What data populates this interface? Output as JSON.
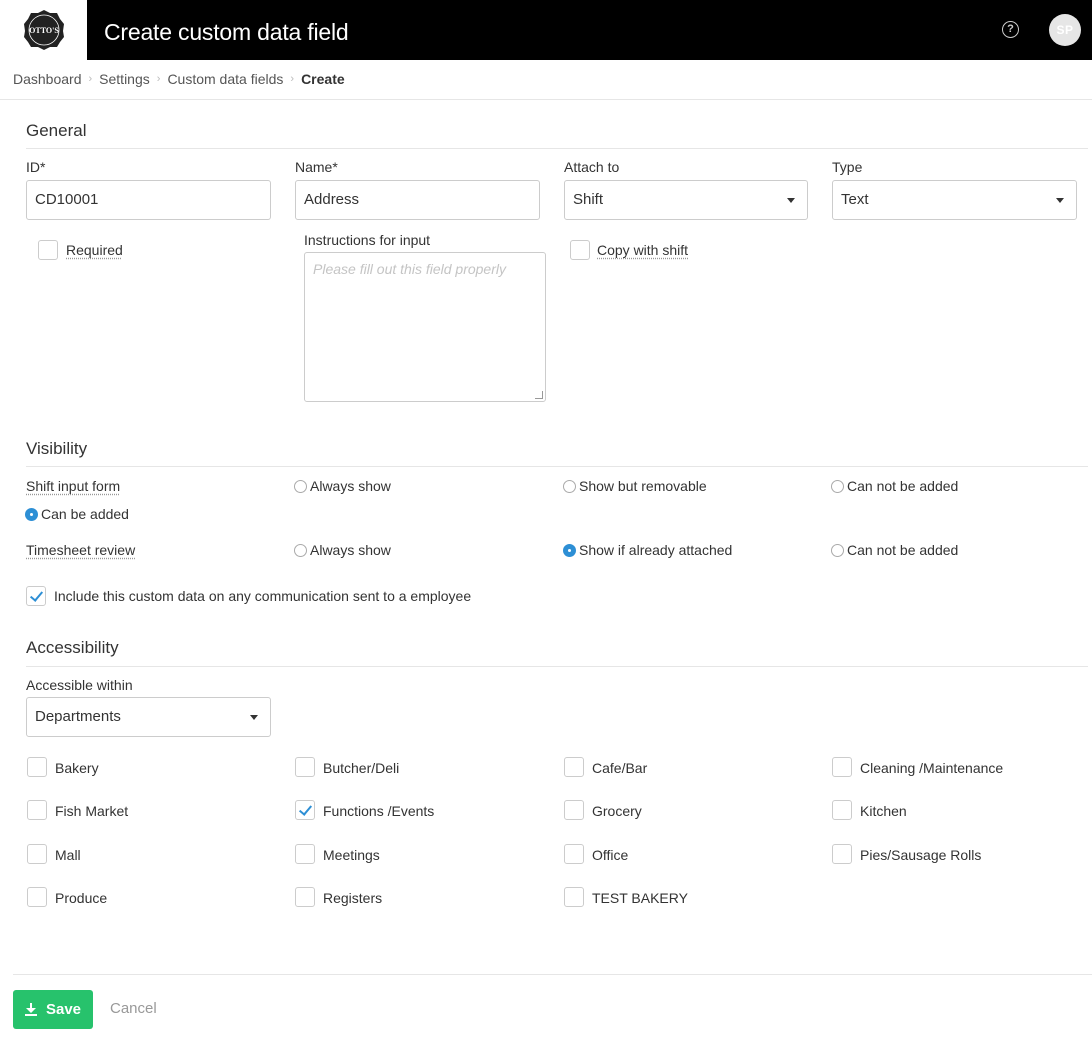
{
  "header": {
    "logo_text": "OTTO'S",
    "title": "Create custom data field",
    "avatar_initials": "SP"
  },
  "breadcrumb": [
    "Dashboard",
    "Settings",
    "Custom data fields",
    "Create"
  ],
  "general": {
    "title": "General",
    "id_label": "ID*",
    "id_value": "CD10001",
    "name_label": "Name*",
    "name_value": "Address",
    "attach_label": "Attach to",
    "attach_value": "Shift",
    "type_label": "Type",
    "type_value": "Text",
    "required_label": "Required",
    "required_checked": false,
    "instructions_label": "Instructions for input",
    "instructions_placeholder": "Please fill out this field properly",
    "copy_label": "Copy with shift",
    "copy_checked": false
  },
  "visibility": {
    "title": "Visibility",
    "shift_input_label": "Shift input form",
    "shift_options": [
      "Always show",
      "Show but removable",
      "Can not be added",
      "Can be added"
    ],
    "shift_selected": "Can be added",
    "timesheet_label": "Timesheet review",
    "timesheet_options": [
      "Always show",
      "Show if already attached",
      "Can not be added"
    ],
    "timesheet_selected": "Show if already attached",
    "include_label": "Include this custom data on any communication sent to a employee",
    "include_checked": true
  },
  "accessibility": {
    "title": "Accessibility",
    "within_label": "Accessible within",
    "within_value": "Departments",
    "departments": [
      {
        "name": "Bakery",
        "checked": false
      },
      {
        "name": "Butcher/Deli",
        "checked": false
      },
      {
        "name": "Cafe/Bar",
        "checked": false
      },
      {
        "name": "Cleaning /Maintenance",
        "checked": false
      },
      {
        "name": "Fish Market",
        "checked": false
      },
      {
        "name": "Functions /Events",
        "checked": true
      },
      {
        "name": "Grocery",
        "checked": false
      },
      {
        "name": "Kitchen",
        "checked": false
      },
      {
        "name": "Mall",
        "checked": false
      },
      {
        "name": "Meetings",
        "checked": false
      },
      {
        "name": "Office",
        "checked": false
      },
      {
        "name": "Pies/Sausage Rolls",
        "checked": false
      },
      {
        "name": "Produce",
        "checked": false
      },
      {
        "name": "Registers",
        "checked": false
      },
      {
        "name": "TEST BAKERY",
        "checked": false
      }
    ]
  },
  "footer": {
    "save_label": "Save",
    "cancel_label": "Cancel"
  },
  "colors": {
    "header_bg": "#000000",
    "accent_blue": "#2d8fd5",
    "save_green": "#27c26c"
  }
}
